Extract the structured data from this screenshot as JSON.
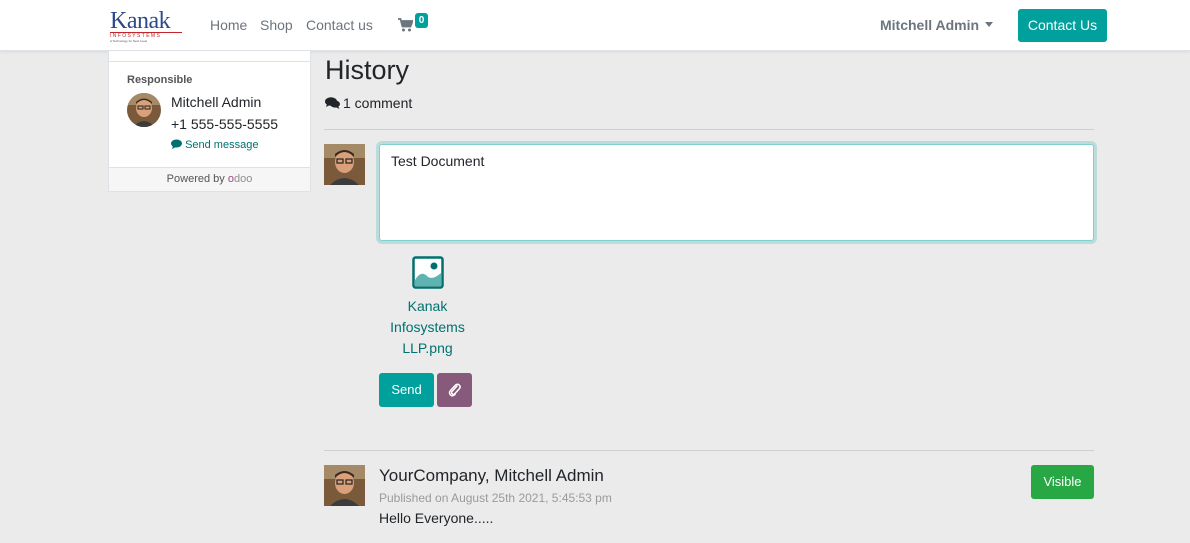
{
  "navbar": {
    "logo": {
      "name": "Kanak",
      "sub": "INFOSYSTEMS",
      "tagline": "A Technology for Next Level"
    },
    "links": [
      "Home",
      "Shop",
      "Contact us"
    ],
    "cart_count": "0",
    "user": "Mitchell Admin",
    "contact_button": "Contact Us"
  },
  "sidebar": {
    "responsible_label": "Responsible",
    "name": "Mitchell Admin",
    "phone": "+1 555-555-5555",
    "send_message": "Send message",
    "powered_by": "Powered by",
    "odoo": {
      "first": "o",
      "rest": "doo"
    }
  },
  "main": {
    "title": "History",
    "comment_count": "1 comment",
    "composer": {
      "text": "Test Document",
      "attachment_name": "Kanak Infosystems LLP.png",
      "send_label": "Send"
    },
    "messages": [
      {
        "author": "YourCompany, Mitchell Admin",
        "date": "Published on August 25th 2021, 5:45:53 pm",
        "body": "Hello Everyone.....",
        "visibility_label": "Visible"
      }
    ]
  },
  "colors": {
    "primary": "#00a09d",
    "secondary": "#875a7b",
    "success": "#28a745",
    "link": "#00716f",
    "background": "#ebebeb"
  },
  "icons": [
    "shopping-cart-icon",
    "comments-icon",
    "comment-icon",
    "image-file-icon",
    "paperclip-icon",
    "caret-down-icon"
  ]
}
